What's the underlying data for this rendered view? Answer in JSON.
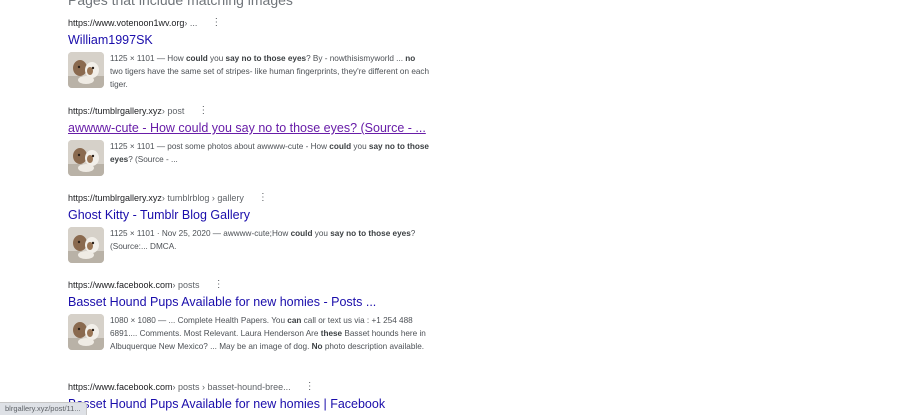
{
  "section_title": "Pages that include matching images",
  "results": [
    {
      "host": "https://www.votenoon1wv.org",
      "path": " › ...",
      "title": "William1997SK",
      "snippet": [
        {
          "t": "1125 × 1101 — How "
        },
        {
          "t": "could",
          "b": true
        },
        {
          "t": " you "
        },
        {
          "t": "say no to those eyes",
          "b": true
        },
        {
          "t": "? By - nowthisismyworld ... "
        },
        {
          "t": "no",
          "b": true
        },
        {
          "t": " two tigers have the same set of stripes- like human fingerprints, they're different on each tiger."
        }
      ]
    },
    {
      "host": "https://tumblrgallery.xyz",
      "path": " › post",
      "title": "awwww-cute - How could you say no to those eyes? (Source - ...",
      "snippet": [
        {
          "t": "1125 × 1101 — post some photos about awwww-cute - How "
        },
        {
          "t": "could",
          "b": true
        },
        {
          "t": " you "
        },
        {
          "t": "say no to those eyes",
          "b": true
        },
        {
          "t": "? (Source - ..."
        }
      ]
    },
    {
      "host": "https://tumblrgallery.xyz",
      "path": " › tumblrblog › gallery",
      "title": "Ghost Kitty - Tumblr Blog Gallery",
      "snippet": [
        {
          "t": "1125 × 1101 · Nov 25, 2020 — awwww-cute;How "
        },
        {
          "t": "could",
          "b": true
        },
        {
          "t": " you "
        },
        {
          "t": "say no to those eyes",
          "b": true
        },
        {
          "t": "? (Source:... DMCA."
        }
      ]
    },
    {
      "host": "https://www.facebook.com",
      "path": " › posts",
      "title": "Basset Hound Pups Available for new homies - Posts ...",
      "snippet": [
        {
          "t": "1080 × 1080 — ... Complete Health Papers. You "
        },
        {
          "t": "can",
          "b": true
        },
        {
          "t": " call or text us via : +1 254 488 6891.... Comments. Most Relevant. Laura Henderson Are "
        },
        {
          "t": "these",
          "b": true
        },
        {
          "t": " Basset hounds here in Albuquerque New Mexico? ... May be an image of dog. "
        },
        {
          "t": "No",
          "b": true
        },
        {
          "t": " photo description available."
        }
      ]
    },
    {
      "host": "https://www.facebook.com",
      "path": " › posts › basset-hound-bree...",
      "title": "Basset Hound Pups Available for new homies | Facebook"
    }
  ],
  "status_bar": "blrgallery.xyz/post/11..."
}
